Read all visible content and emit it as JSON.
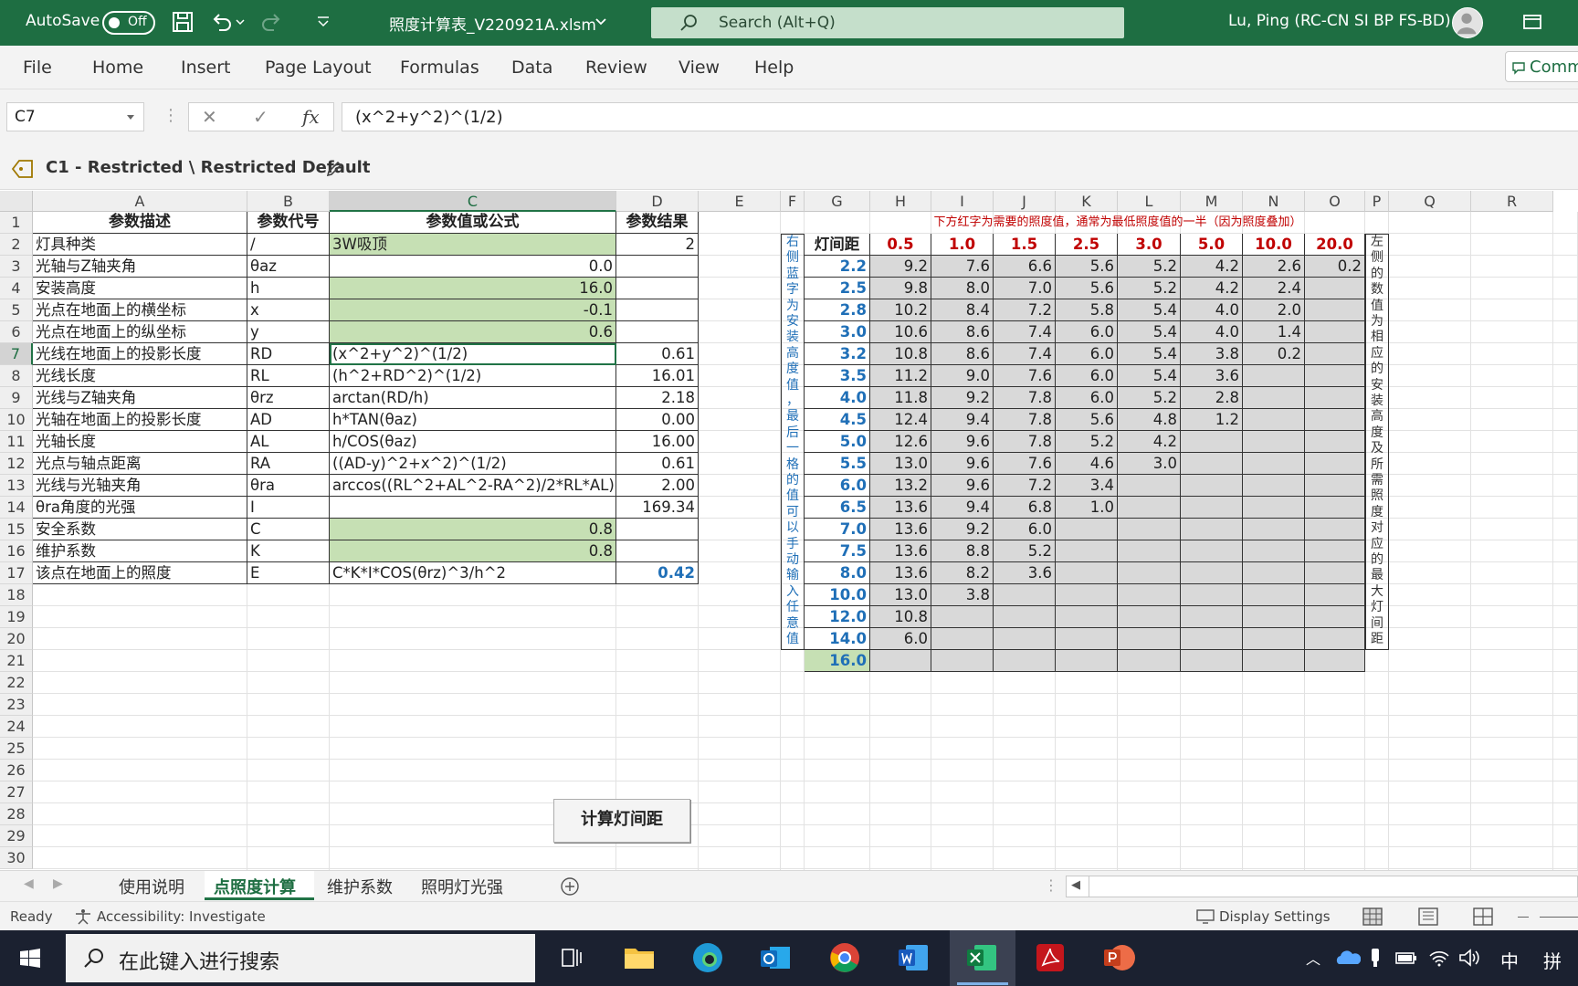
{
  "titlebar": {
    "autosave": "AutoSave",
    "toggle": "Off",
    "filename": "照度计算表_V220921A.xlsm",
    "search_placeholder": "Search (Alt+Q)",
    "user": "Lu, Ping (RC-CN SI BP FS-BD)"
  },
  "ribbon": {
    "tabs": [
      "File",
      "Home",
      "Insert",
      "Page Layout",
      "Formulas",
      "Data",
      "Review",
      "View",
      "Help"
    ],
    "comments": "Comm"
  },
  "formula_bar": {
    "name_box": "C7",
    "formula": "(x^2+y^2)^(1/2)"
  },
  "sensitivity": "C1 - Restricted \\ Restricted Default",
  "columns": [
    "A",
    "B",
    "C",
    "D",
    "E",
    "F",
    "G",
    "H",
    "I",
    "J",
    "K",
    "L",
    "M",
    "N",
    "O",
    "P",
    "Q",
    "R"
  ],
  "rows": [
    "1",
    "2",
    "3",
    "4",
    "5",
    "6",
    "7",
    "8",
    "9",
    "10",
    "11",
    "12",
    "13",
    "14",
    "15",
    "16",
    "17",
    "18",
    "19",
    "20",
    "21",
    "22",
    "23",
    "24",
    "25",
    "26",
    "27",
    "28",
    "29",
    "30"
  ],
  "param_table": {
    "headers": [
      "参数描述",
      "参数代号",
      "参数值或公式",
      "参数结果"
    ],
    "rows": [
      [
        "灯具种类",
        "/",
        "3W吸顶",
        "2"
      ],
      [
        "光轴与Z轴夹角",
        "θaz",
        "0.0",
        ""
      ],
      [
        "安装高度",
        "h",
        "16.0",
        ""
      ],
      [
        "光点在地面上的横坐标",
        "x",
        "-0.1",
        ""
      ],
      [
        "光点在地面上的纵坐标",
        "y",
        "0.6",
        ""
      ],
      [
        "光线在地面上的投影长度",
        "RD",
        "(x^2+y^2)^(1/2)",
        "0.61"
      ],
      [
        "光线长度",
        "RL",
        "(h^2+RD^2)^(1/2)",
        "16.01"
      ],
      [
        "光线与Z轴夹角",
        "θrz",
        "arctan(RD/h)",
        "2.18"
      ],
      [
        "光轴在地面上的投影长度",
        "AD",
        "h*TAN(θaz)",
        "0.00"
      ],
      [
        "光轴长度",
        "AL",
        "h/COS(θaz)",
        "16.00"
      ],
      [
        "光点与轴点距离",
        "RA",
        "((AD-y)^2+x^2)^(1/2)",
        "0.61"
      ],
      [
        "光线与光轴夹角",
        "θra",
        "arccos((RL^2+AL^2-RA^2)/2*RL*AL)",
        "2.00"
      ],
      [
        "θra角度的光强",
        "I",
        "",
        "169.34"
      ],
      [
        "安全系数",
        "C",
        "0.8",
        ""
      ],
      [
        "维护系数",
        "K",
        "0.8",
        ""
      ],
      [
        "该点在地面上的照度",
        "E",
        "C*K*I*COS(θrz)^3/h^2",
        "0.42"
      ]
    ]
  },
  "calc_button": "计算灯间距",
  "spacing_table": {
    "note": "下方红字为需要的照度值，通常为最低照度值的一半（因为照度叠加）",
    "corner": "灯间距",
    "lux_headers": [
      "0.5",
      "1.0",
      "1.5",
      "2.5",
      "3.0",
      "5.0",
      "10.0",
      "20.0"
    ],
    "heights": [
      "2.2",
      "2.5",
      "2.8",
      "3.0",
      "3.2",
      "3.5",
      "4.0",
      "4.5",
      "5.0",
      "5.5",
      "6.0",
      "6.5",
      "7.0",
      "7.5",
      "8.0",
      "10.0",
      "12.0",
      "14.0",
      "16.0"
    ],
    "values": [
      [
        "9.2",
        "7.6",
        "6.6",
        "5.6",
        "5.2",
        "4.2",
        "2.6",
        "0.2"
      ],
      [
        "9.8",
        "8.0",
        "7.0",
        "5.6",
        "5.2",
        "4.2",
        "2.4",
        ""
      ],
      [
        "10.2",
        "8.4",
        "7.2",
        "5.8",
        "5.4",
        "4.0",
        "2.0",
        ""
      ],
      [
        "10.6",
        "8.6",
        "7.4",
        "6.0",
        "5.4",
        "4.0",
        "1.4",
        ""
      ],
      [
        "10.8",
        "8.6",
        "7.4",
        "6.0",
        "5.4",
        "3.8",
        "0.2",
        ""
      ],
      [
        "11.2",
        "9.0",
        "7.6",
        "6.0",
        "5.4",
        "3.6",
        "",
        ""
      ],
      [
        "11.8",
        "9.2",
        "7.8",
        "6.0",
        "5.2",
        "2.8",
        "",
        ""
      ],
      [
        "12.4",
        "9.4",
        "7.8",
        "5.6",
        "4.8",
        "1.2",
        "",
        ""
      ],
      [
        "12.6",
        "9.6",
        "7.8",
        "5.2",
        "4.2",
        "",
        "",
        ""
      ],
      [
        "13.0",
        "9.6",
        "7.6",
        "4.6",
        "3.0",
        "",
        "",
        ""
      ],
      [
        "13.2",
        "9.6",
        "7.2",
        "3.4",
        "",
        "",
        "",
        ""
      ],
      [
        "13.6",
        "9.4",
        "6.8",
        "1.0",
        "",
        "",
        "",
        ""
      ],
      [
        "13.6",
        "9.2",
        "6.0",
        "",
        "",
        "",
        "",
        ""
      ],
      [
        "13.6",
        "8.8",
        "5.2",
        "",
        "",
        "",
        "",
        ""
      ],
      [
        "13.6",
        "8.2",
        "3.6",
        "",
        "",
        "",
        "",
        ""
      ],
      [
        "13.0",
        "3.8",
        "",
        "",
        "",
        "",
        "",
        ""
      ],
      [
        "10.8",
        "",
        "",
        "",
        "",
        "",
        "",
        ""
      ],
      [
        "6.0",
        "",
        "",
        "",
        "",
        "",
        "",
        ""
      ],
      [
        "",
        "",
        "",
        "",
        "",
        "",
        "",
        ""
      ]
    ],
    "left_note": [
      "右",
      "侧",
      "蓝",
      "字",
      "为",
      "安",
      "装",
      "高",
      "度",
      "值",
      "，",
      "最",
      "后",
      "一",
      "格",
      "的",
      "值",
      "可",
      "以",
      "手",
      "动",
      "输",
      "入",
      "任",
      "意",
      "值"
    ],
    "right_note": [
      "左",
      "侧",
      "的",
      "数",
      "值",
      "为",
      "相",
      "应",
      "的",
      "安",
      "装",
      "高",
      "度",
      "及",
      "所",
      "需",
      "照",
      "度",
      "对",
      "应",
      "的",
      "最",
      "大",
      "灯",
      "间",
      "距"
    ]
  },
  "sheet_tabs": [
    "使用说明",
    "点照度计算",
    "维护系数",
    "照明灯光强"
  ],
  "status": {
    "ready": "Ready",
    "accessibility": "Accessibility: Investigate",
    "display_settings": "Display Settings"
  },
  "taskbar": {
    "search_placeholder": "在此键入进行搜索",
    "ime": "中",
    "ime2": "拼"
  },
  "colors": {
    "excel_green": "#1e6e42",
    "input_green": "#c6e0b4",
    "table_gray": "#d9d9d9",
    "value_blue": "#1f6fb7",
    "lux_red": "#c00000"
  }
}
